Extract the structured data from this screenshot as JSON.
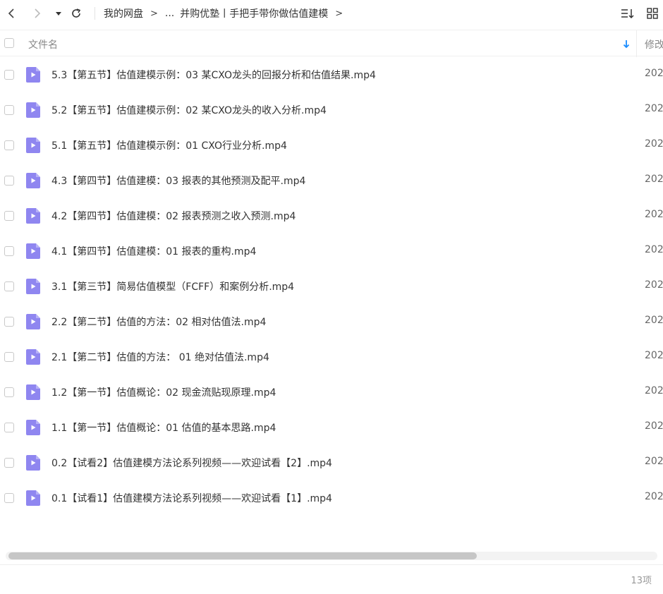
{
  "toolbar": {
    "breadcrumb": [
      "我的网盘",
      "...",
      "并购优塾丨手把手带你做估值建模"
    ],
    "icons": [
      "back-icon",
      "forward-icon",
      "history-dropdown-icon",
      "refresh-icon",
      "sort-list-icon",
      "grid-view-icon"
    ]
  },
  "table": {
    "header": {
      "name": "文件名",
      "modified": "修改"
    },
    "rows": [
      {
        "name": "5.3【第五节】估值建模示例：03 某CXO龙头的回报分析和估值结果.mp4",
        "date": "202"
      },
      {
        "name": "5.2【第五节】估值建模示例：02 某CXO龙头的收入分析.mp4",
        "date": "202"
      },
      {
        "name": "5.1【第五节】估值建模示例：01 CXO行业分析.mp4",
        "date": "202"
      },
      {
        "name": "4.3【第四节】估值建模：03 报表的其他预测及配平.mp4",
        "date": "202"
      },
      {
        "name": "4.2【第四节】估值建模：02 报表预测之收入预测.mp4",
        "date": "202"
      },
      {
        "name": "4.1【第四节】估值建模：01 报表的重构.mp4",
        "date": "202"
      },
      {
        "name": "3.1【第三节】简易估值模型（FCFF）和案例分析.mp4",
        "date": "202"
      },
      {
        "name": "2.2【第二节】估值的方法：02 相对估值法.mp4",
        "date": "202"
      },
      {
        "name": "2.1【第二节】估值的方法： 01 绝对估值法.mp4",
        "date": "202"
      },
      {
        "name": "1.2【第一节】估值概论：02 现金流贴现原理.mp4",
        "date": "202"
      },
      {
        "name": "1.1【第一节】估值概论：01 估值的基本思路.mp4",
        "date": "202"
      },
      {
        "name": "0.2【试看2】估值建模方法论系列视频——欢迎试看【2】.mp4",
        "date": "202"
      },
      {
        "name": "0.1【试看1】估值建模方法论系列视频——欢迎试看【1】.mp4",
        "date": "202"
      }
    ]
  },
  "footer": {
    "count": "13项"
  },
  "colors": {
    "accent": "#1a8cff",
    "file_icon": "#8f86f0"
  }
}
